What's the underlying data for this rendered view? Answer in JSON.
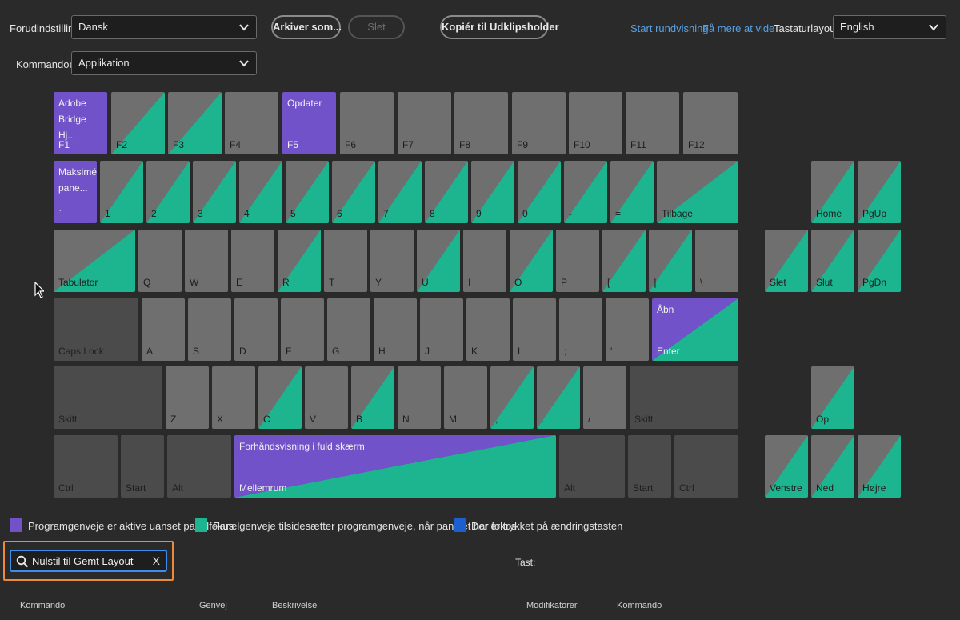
{
  "toolbar": {
    "preset_label": "Forudindstilling:",
    "preset_value": "Dansk",
    "save_as_label": "Arkiver som...",
    "delete_label": "Slet",
    "copy_label": "Kopiér til Udklipsholder",
    "tour_link": "Start rundvisning",
    "learn_link": "Få mere at vide",
    "layout_label": "Tastaturlayout:",
    "layout_value": "English",
    "commands_label": "Kommandoer:",
    "commands_value": "Applikation"
  },
  "keyboard": {
    "row_fn": [
      {
        "name": "F1",
        "command": "Adobe Bridge Hj...",
        "type": "purple"
      },
      {
        "name": "F2",
        "type": "panel"
      },
      {
        "name": "F3",
        "type": "panel"
      },
      {
        "name": "F4",
        "type": "gray"
      },
      {
        "name": "F5",
        "command": "Opdater",
        "type": "purple"
      },
      {
        "name": "F6",
        "type": "gray"
      },
      {
        "name": "F7",
        "type": "gray"
      },
      {
        "name": "F8",
        "type": "gray"
      },
      {
        "name": "F9",
        "type": "gray"
      },
      {
        "name": "F10",
        "type": "gray"
      },
      {
        "name": "F11",
        "type": "gray"
      },
      {
        "name": "F12",
        "type": "gray"
      }
    ],
    "row_num": [
      {
        "name": "`",
        "command": "Maksimér pane...",
        "type": "purple"
      },
      {
        "name": "1",
        "type": "panel"
      },
      {
        "name": "2",
        "type": "panel"
      },
      {
        "name": "3",
        "type": "panel"
      },
      {
        "name": "4",
        "type": "panel"
      },
      {
        "name": "5",
        "type": "panel"
      },
      {
        "name": "6",
        "type": "panel"
      },
      {
        "name": "7",
        "type": "panel"
      },
      {
        "name": "8",
        "type": "panel"
      },
      {
        "name": "9",
        "type": "panel"
      },
      {
        "name": "0",
        "type": "panel"
      },
      {
        "name": "-",
        "type": "panel"
      },
      {
        "name": "=",
        "type": "panel"
      },
      {
        "name": "Tilbage",
        "type": "panel"
      }
    ],
    "row_tab": [
      {
        "name": "Tabulator",
        "type": "panel"
      },
      {
        "name": "Q",
        "type": "gray"
      },
      {
        "name": "W",
        "type": "gray"
      },
      {
        "name": "E",
        "type": "gray"
      },
      {
        "name": "R",
        "type": "panel"
      },
      {
        "name": "T",
        "type": "gray"
      },
      {
        "name": "Y",
        "type": "gray"
      },
      {
        "name": "U",
        "type": "panel"
      },
      {
        "name": "I",
        "type": "gray"
      },
      {
        "name": "O",
        "type": "panel"
      },
      {
        "name": "P",
        "type": "gray"
      },
      {
        "name": "[",
        "type": "panel"
      },
      {
        "name": "]",
        "type": "panel"
      },
      {
        "name": "\\",
        "type": "gray"
      }
    ],
    "row_caps": [
      {
        "name": "Caps Lock",
        "type": "dark"
      },
      {
        "name": "A",
        "type": "gray"
      },
      {
        "name": "S",
        "type": "gray"
      },
      {
        "name": "D",
        "type": "gray"
      },
      {
        "name": "F",
        "type": "gray"
      },
      {
        "name": "G",
        "type": "gray"
      },
      {
        "name": "H",
        "type": "gray"
      },
      {
        "name": "J",
        "type": "gray"
      },
      {
        "name": "K",
        "type": "gray"
      },
      {
        "name": "L",
        "type": "gray"
      },
      {
        "name": ";",
        "type": "gray"
      },
      {
        "name": "'",
        "type": "gray"
      },
      {
        "name": "Enter",
        "command": "Åbn",
        "type": "mixed"
      }
    ],
    "row_shift": [
      {
        "name": "Skift",
        "type": "dark"
      },
      {
        "name": "Z",
        "type": "gray"
      },
      {
        "name": "X",
        "type": "gray"
      },
      {
        "name": "C",
        "type": "panel"
      },
      {
        "name": "V",
        "type": "gray"
      },
      {
        "name": "B",
        "type": "panel"
      },
      {
        "name": "N",
        "type": "gray"
      },
      {
        "name": "M",
        "type": "gray"
      },
      {
        "name": ",",
        "type": "panel"
      },
      {
        "name": ".",
        "type": "panel"
      },
      {
        "name": "/",
        "type": "gray"
      },
      {
        "name": "Skift",
        "type": "dark"
      }
    ],
    "row_ctrl": [
      {
        "name": "Ctrl",
        "type": "dark"
      },
      {
        "name": "Start",
        "type": "dark"
      },
      {
        "name": "Alt",
        "type": "dark"
      },
      {
        "name": "Mellemrum",
        "command": "Forhåndsvisning i fuld skærm",
        "type": "mixed"
      },
      {
        "name": "Alt",
        "type": "dark"
      },
      {
        "name": "Start",
        "type": "dark"
      },
      {
        "name": "Ctrl",
        "type": "dark"
      }
    ],
    "nav": [
      {
        "name": "Home",
        "type": "panel"
      },
      {
        "name": "PgUp",
        "type": "panel"
      },
      {
        "name": "Slet",
        "type": "panel"
      },
      {
        "name": "Slut",
        "type": "panel"
      },
      {
        "name": "PgDn",
        "type": "panel"
      },
      {
        "name": "Op",
        "type": "panel"
      },
      {
        "name": "Venstre",
        "type": "panel"
      },
      {
        "name": "Ned",
        "type": "panel"
      },
      {
        "name": "Højre",
        "type": "panel"
      }
    ]
  },
  "legend": {
    "app": "Programgenveje er aktive uanset panelfokus",
    "panel": "Panelgenveje tilsidesætter programgenveje, når panelet har fokus",
    "modifier": "Der er trykket på ændringstasten"
  },
  "colors": {
    "app": "#7152c8",
    "panel": "#1cb58f",
    "modifier": "#1e5fcf",
    "key": "#6f6f6f",
    "key_dark": "#4b4b4b",
    "link": "#5aa0e0",
    "search_highlight": "#ec8a3a"
  },
  "search": {
    "value": "Nulstil til Gemt Layout",
    "clear": "X"
  },
  "key_label": "Tast:",
  "columns": {
    "command": "Kommando",
    "shortcut": "Genvej",
    "description": "Beskrivelse",
    "modifiers": "Modifikatorer",
    "command2": "Kommando"
  }
}
